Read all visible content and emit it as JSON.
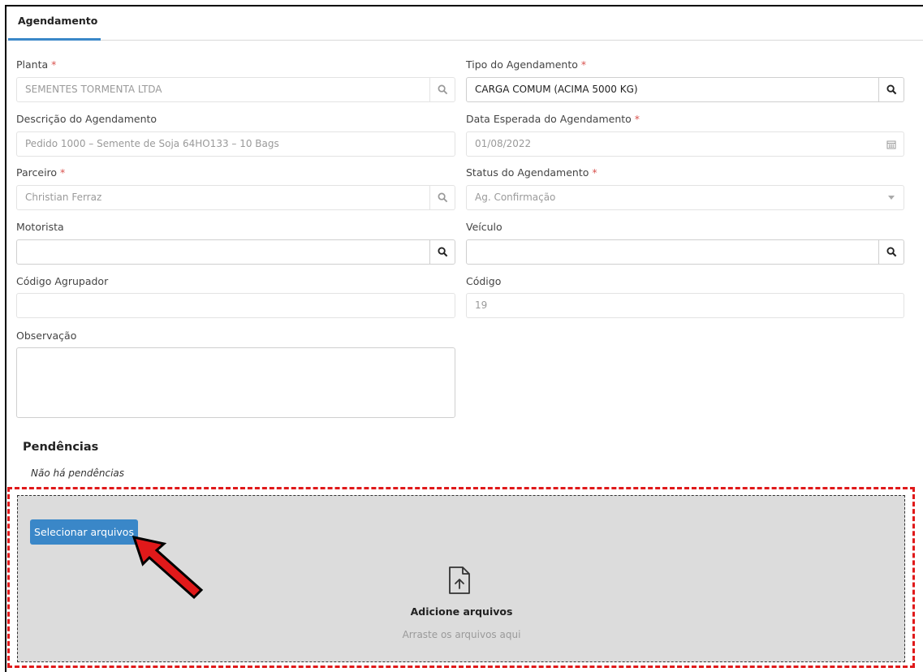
{
  "tab": {
    "label": "Agendamento"
  },
  "required_mark": "*",
  "fields": {
    "planta": {
      "label": "Planta",
      "value": "SEMENTES TORMENTA LTDA",
      "icon": "search-icon"
    },
    "tipo": {
      "label": "Tipo do Agendamento",
      "value": "CARGA COMUM (ACIMA 5000 KG)",
      "icon": "search-icon"
    },
    "descricao": {
      "label": "Descrição do Agendamento",
      "value": "Pedido 1000 – Semente de Soja 64HO133 – 10 Bags"
    },
    "data": {
      "label": "Data Esperada do Agendamento",
      "value": "01/08/2022",
      "icon": "calendar-icon"
    },
    "parceiro": {
      "label": "Parceiro",
      "value": "Christian Ferraz",
      "icon": "search-icon"
    },
    "status": {
      "label": "Status do Agendamento",
      "value": "Ag. Confirmação",
      "icon": "caret-down-icon"
    },
    "motorista": {
      "label": "Motorista",
      "value": "",
      "icon": "search-icon"
    },
    "veiculo": {
      "label": "Veículo",
      "value": "",
      "icon": "search-icon"
    },
    "agrupador": {
      "label": "Código Agrupador",
      "value": ""
    },
    "codigo": {
      "label": "Código",
      "value": "19"
    },
    "observacao": {
      "label": "Observação",
      "value": ""
    }
  },
  "pendencias": {
    "title": "Pendências",
    "empty_text": "Não há pendências"
  },
  "upload": {
    "button_label": "Selecionar arquivos",
    "icon": "file-upload-icon",
    "title": "Adicione arquivos",
    "subtitle": "Arraste os arquivos aqui"
  },
  "colors": {
    "accent": "#3a87c8",
    "required": "#d9534f",
    "highlight": "#e0191a",
    "dropzone": "#dcdcdc"
  }
}
